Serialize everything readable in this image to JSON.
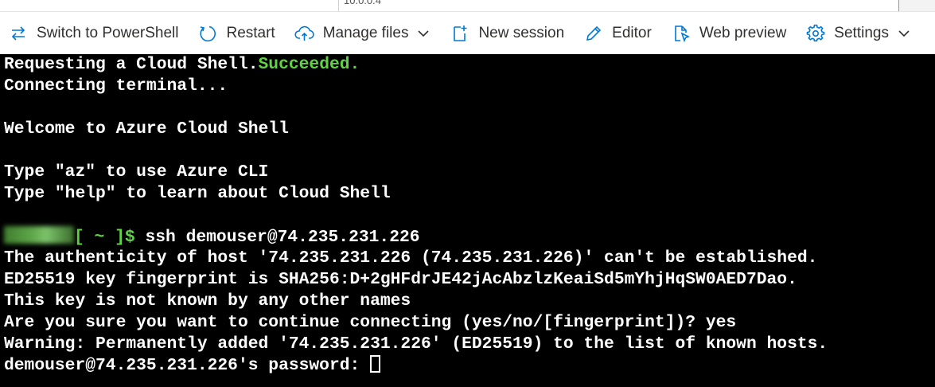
{
  "top_strip": {
    "fragment": "10.0.0.4"
  },
  "toolbar": {
    "switch_label": "Switch to PowerShell",
    "restart_label": "Restart",
    "manage_files_label": "Manage files",
    "new_session_label": "New session",
    "editor_label": "Editor",
    "web_preview_label": "Web preview",
    "settings_label": "Settings"
  },
  "colors": {
    "accent": "#0078d4",
    "success_green": "#61d345",
    "terminal_bg": "#000000",
    "terminal_fg": "#ffffff"
  },
  "terminal": {
    "line1_prefix": "Requesting a Cloud Shell.",
    "line1_status": "Succeeded.",
    "line2": "Connecting terminal...",
    "line3": "Welcome to Azure Cloud Shell",
    "line4": "Type \"az\" to use Azure CLI",
    "line5": "Type \"help\" to learn about Cloud Shell",
    "prompt": "[ ~ ]$",
    "command": " ssh demouser@74.235.231.226",
    "line7": "The authenticity of host '74.235.231.226 (74.235.231.226)' can't be established.",
    "line8": "ED25519 key fingerprint is SHA256:D+2gHFdrJE42jAcAbzlzKeaiSd5mYhjHqSW0AED7Dao.",
    "line9": "This key is not known by any other names",
    "line10": "Are you sure you want to continue connecting (yes/no/[fingerprint])? yes",
    "line11": "Warning: Permanently added '74.235.231.226' (ED25519) to the list of known hosts.",
    "line12": "demouser@74.235.231.226's password: "
  }
}
